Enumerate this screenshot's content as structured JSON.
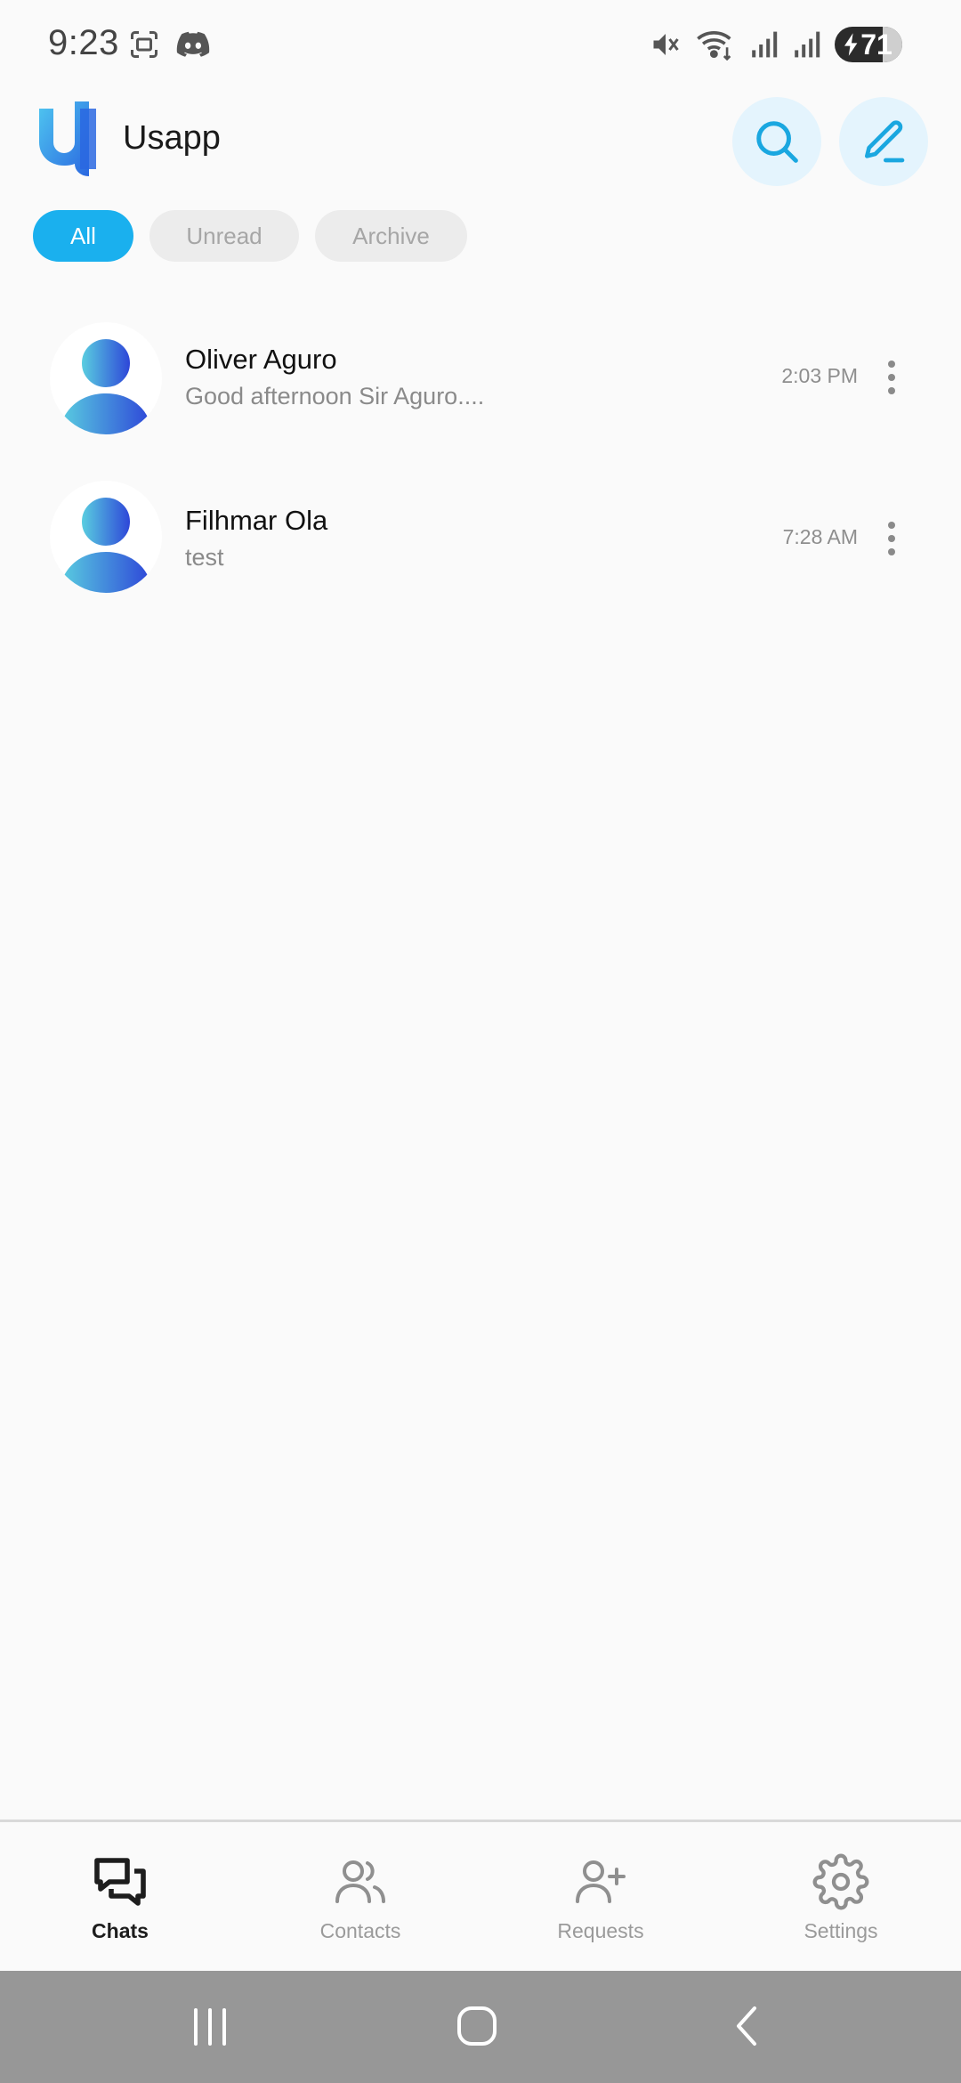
{
  "status_bar": {
    "time": "9:23",
    "battery": "71",
    "icons": [
      "screenshot-icon",
      "discord-icon",
      "mute-icon",
      "wifi-icon",
      "signal-icon",
      "signal-icon",
      "battery-charging-icon"
    ]
  },
  "header": {
    "app_name": "Usapp",
    "search_icon": "search-icon",
    "compose_icon": "pencil-icon"
  },
  "filters": [
    {
      "label": "All",
      "active": true
    },
    {
      "label": "Unread",
      "active": false
    },
    {
      "label": "Archive",
      "active": false
    }
  ],
  "chats": [
    {
      "name": "Oliver Aguro",
      "preview": "Good afternoon Sir Aguro....",
      "time": "2:03 PM"
    },
    {
      "name": "Filhmar Ola",
      "preview": "test",
      "time": "7:28 AM"
    }
  ],
  "bottom_nav": [
    {
      "label": "Chats",
      "icon": "chats-icon",
      "active": true
    },
    {
      "label": "Contacts",
      "icon": "contacts-icon",
      "active": false
    },
    {
      "label": "Requests",
      "icon": "add-user-icon",
      "active": false
    },
    {
      "label": "Settings",
      "icon": "gear-icon",
      "active": false
    }
  ],
  "colors": {
    "accent": "#1ab0ee",
    "accent_light": "#e4f4fd",
    "avatar_gradient_start": "#5ad0e0",
    "avatar_gradient_end": "#2d44d8",
    "background": "#fafafa"
  }
}
